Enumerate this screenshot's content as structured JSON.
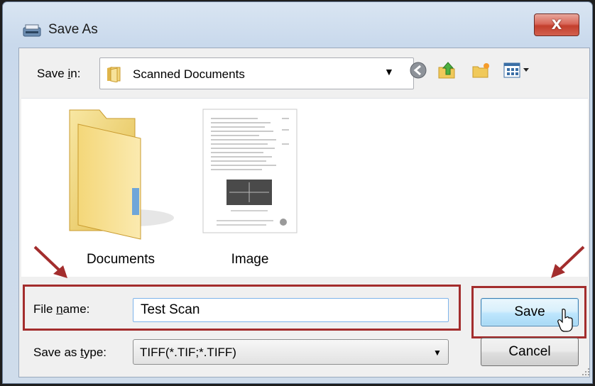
{
  "window": {
    "title": "Save As",
    "close_glyph": "X"
  },
  "toolbar": {
    "save_in_label_pre": "Save ",
    "save_in_label_key": "i",
    "save_in_label_post": "n:",
    "location": "Scanned Documents",
    "icons": [
      "back-icon",
      "up-folder-icon",
      "new-folder-icon",
      "view-menu-icon"
    ]
  },
  "files": [
    {
      "name": "Documents",
      "type": "folder"
    },
    {
      "name": "Image",
      "type": "image-file"
    }
  ],
  "form": {
    "file_name_label_pre": "File ",
    "file_name_label_key": "n",
    "file_name_label_post": "ame:",
    "file_name_value": "Test Scan",
    "save_type_label_pre": "Save as ",
    "save_type_label_key": "t",
    "save_type_label_post": "ype:",
    "save_type_value": "TIFF(*.TIF;*.TIFF)"
  },
  "buttons": {
    "save": "Save",
    "cancel": "Cancel"
  },
  "annotations": {
    "highlight_color": "#a32d2d"
  }
}
